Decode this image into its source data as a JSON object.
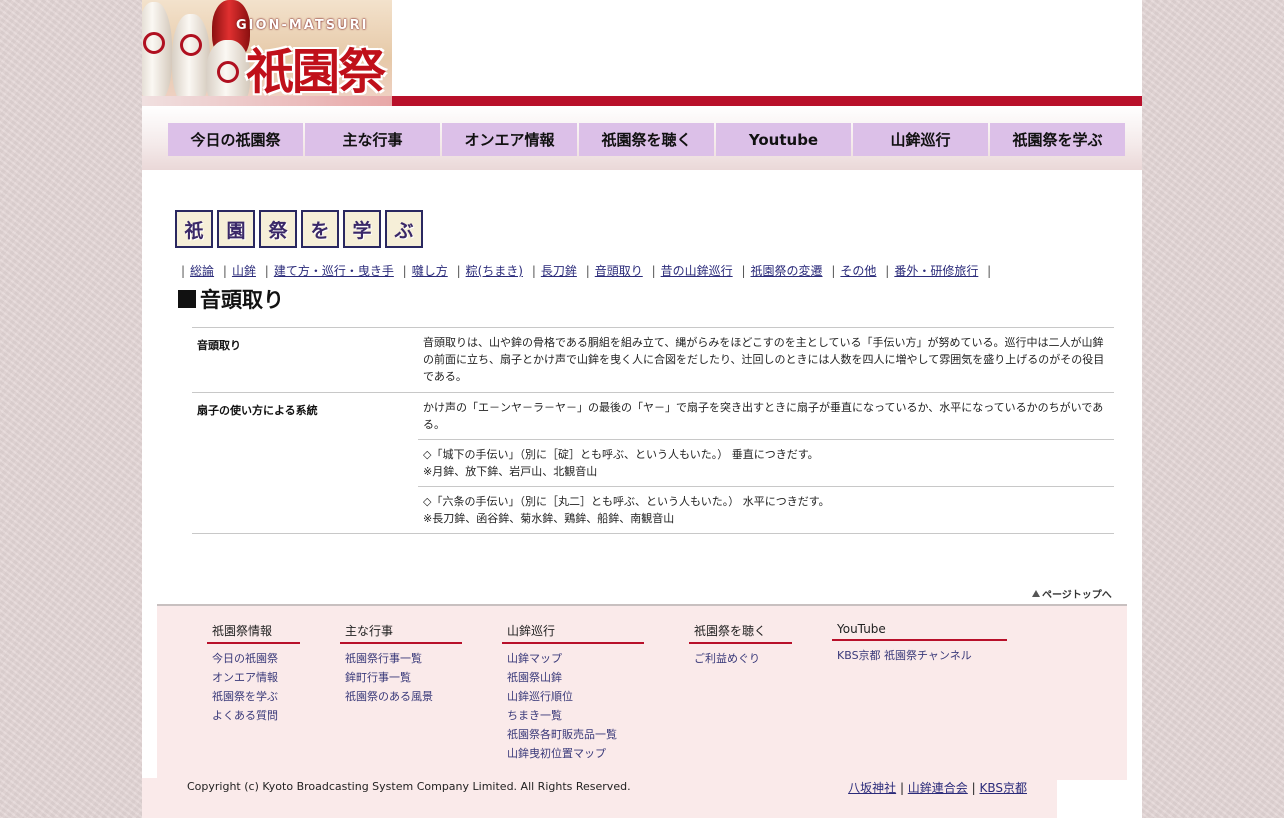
{
  "header": {
    "logo_en": "GION-MATSURI",
    "logo_jp": "祇園祭"
  },
  "nav": [
    "今日の祇園祭",
    "主な行事",
    "オンエア情報",
    "祇園祭を聴く",
    "Youtube",
    "山鉾巡行",
    "祇園祭を学ぶ"
  ],
  "page_title_chars": [
    "祇",
    "園",
    "祭",
    "を",
    "学",
    "ぶ"
  ],
  "subnav": [
    "総論",
    "山鉾",
    "建て方・巡行・曳き手",
    "囃し方",
    "粽(ちまき)",
    "長刀鉾",
    "音頭取り",
    "昔の山鉾巡行",
    "祇園祭の変遷",
    "その他",
    "番外・研修旅行"
  ],
  "section_heading": "音頭取り",
  "table": {
    "row1": {
      "label": "音頭取り",
      "text": "音頭取りは、山や鉾の骨格である胴組を組み立て、縄がらみをほどこすのを主としている「手伝い方」が努めている。巡行中は二人が山鉾の前面に立ち、扇子とかけ声で山鉾を曳く人に合図をだしたり、辻回しのときには人数を四人に増やして雰囲気を盛り上げるのがその役目である。"
    },
    "row2": {
      "label": "扇子の使い方による系統",
      "intro": "かけ声の「エ－ンヤ－ラ－ヤ－」の最後の「ヤ－」で扇子を突き出すときに扇子が垂直になっているか、水平になっているかのちがいである。",
      "joka_line1": "◇「城下の手伝い」（別に［碇］とも呼ぶ、という人もいた。） 垂直につきだす。",
      "joka_line2": "※月鉾、放下鉾、岩戸山、北観音山",
      "rokujo_line1": "◇「六条の手伝い」（別に［丸二］とも呼ぶ、という人もいた。） 水平につきだす。",
      "rokujo_line2": "※長刀鉾、函谷鉾、菊水鉾、鶏鉾、船鉾、南観音山"
    }
  },
  "pagetop": "ページトップへ",
  "footer": {
    "columns": [
      {
        "head": "祇園祭情報",
        "items": [
          "今日の祇園祭",
          "オンエア情報",
          "祇園祭を学ぶ",
          "よくある質問"
        ]
      },
      {
        "head": "主な行事",
        "items": [
          "祇園祭行事一覧",
          "鉾町行事一覧",
          "祇園祭のある風景"
        ]
      },
      {
        "head": "山鉾巡行",
        "items": [
          "山鉾マップ",
          "祇園祭山鉾",
          "山鉾巡行順位",
          "ちまき一覧",
          "祇園祭各町販売品一覧",
          "山鉾曳初位置マップ"
        ]
      },
      {
        "head": "祇園祭を聴く",
        "items": [
          "ご利益めぐり"
        ]
      },
      {
        "head": "YouTube",
        "items": [
          "KBS京都 祇園祭チャンネル"
        ]
      }
    ],
    "copyright": "Copyright (c) Kyoto Broadcasting System Company Limited. All Rights Reserved.",
    "links": [
      "八坂神社",
      "山鉾連合会",
      "KBS京都"
    ]
  }
}
